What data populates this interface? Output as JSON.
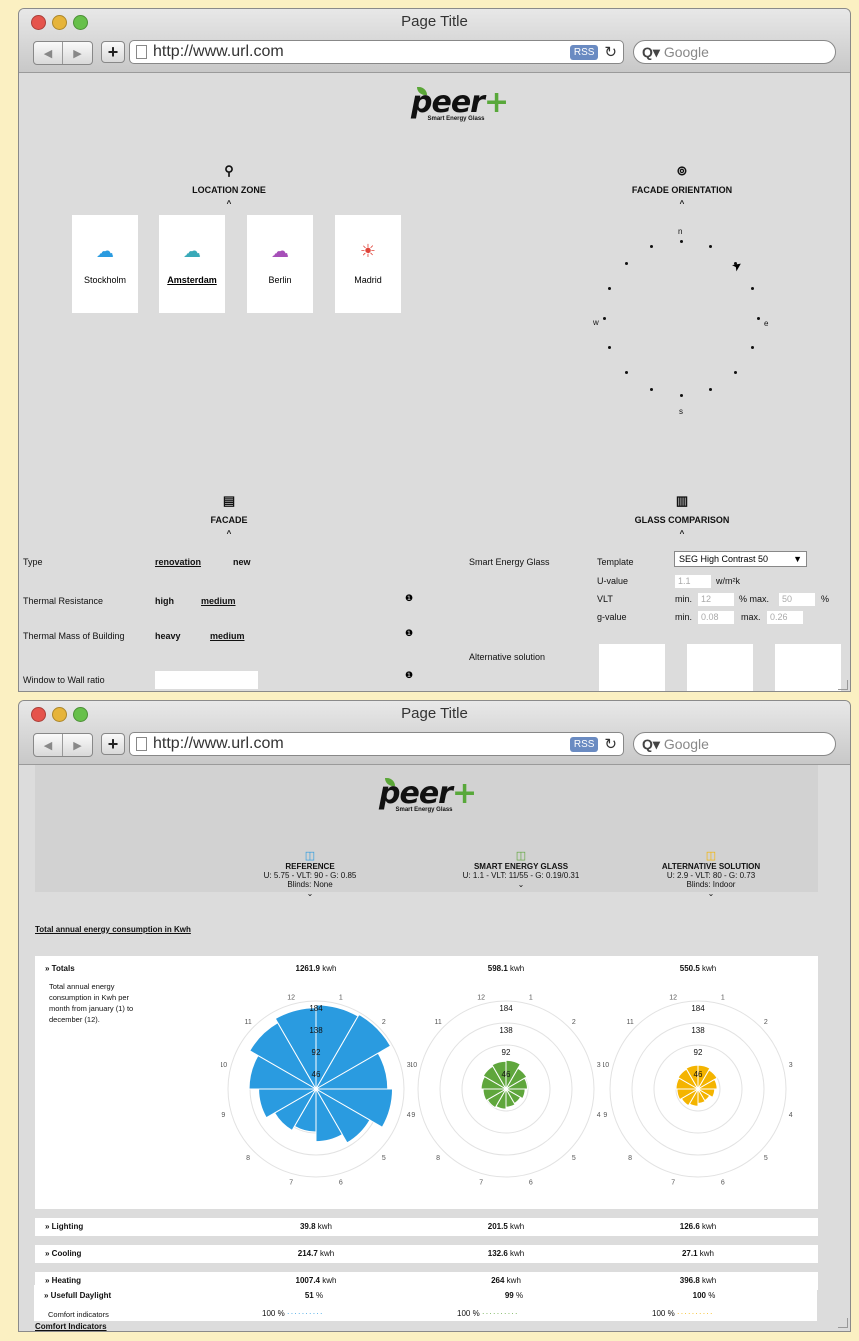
{
  "window1": {
    "title": "Page Title",
    "url": "http://www.url.com",
    "rss": "RSS",
    "search_placeholder": "Google",
    "logo": {
      "name": "peer",
      "plus": "+",
      "tagline": "Smart Energy Glass"
    },
    "location": {
      "title": "LOCATION ZONE",
      "cities": [
        "Stockholm",
        "Amsterdam",
        "Berlin",
        "Madrid"
      ]
    },
    "orientation": {
      "title": "FACADE ORIENTATION",
      "n": "n",
      "s": "s",
      "e": "e",
      "w": "w"
    },
    "facade": {
      "title": "FACADE",
      "type_label": "Type",
      "type_opt1": "renovation",
      "type_opt2": "new",
      "thermal_res_label": "Thermal Resistance",
      "thermal_res_opt1": "high",
      "thermal_res_opt2": "medium",
      "thermal_mass_label": "Thermal Mass of Building",
      "thermal_mass_opt1": "heavy",
      "thermal_mass_opt2": "medium",
      "wwr_label": "Window to Wall ratio"
    },
    "glass": {
      "title": "GLASS COMPARISON",
      "seg_label": "Smart Energy Glass",
      "template_label": "Template",
      "template_value": "SEG High Contrast 50",
      "uvalue_label": "U-value",
      "uvalue": "1.1",
      "uvalue_unit": "w/m²k",
      "vlt_label": "VLT",
      "vlt_min_label": "min.",
      "vlt_min": "12",
      "vlt_max_label": "% max.",
      "vlt_max": "50",
      "vlt_unit": "%",
      "g_label": "g-value",
      "g_min_label": "min.",
      "g_min": "0.08",
      "g_max_label": "max.",
      "g_max": "0.26",
      "alt_label": "Alternative solution"
    }
  },
  "window2": {
    "title": "Page Title",
    "url": "http://www.url.com",
    "rss": "RSS",
    "search_placeholder": "Google",
    "columns": [
      {
        "name": "REFERENCE",
        "spec": "U: 5.75 - VLT: 90 - G: 0.85",
        "blinds": "Blinds: None",
        "color": "#2a9be0"
      },
      {
        "name": "SMART ENERGY GLASS",
        "spec": "U: 1.1 - VLT: 11/55 - G: 0.19/0.31",
        "blinds": "",
        "color": "#5fa63c"
      },
      {
        "name": "ALTERNATIVE SOLUTION",
        "spec": "U: 2.9 - VLT: 80 - G: 0.73",
        "blinds": "Blinds: Indoor",
        "color": "#f4b400"
      }
    ],
    "energy_heading": "Total annual energy consumption in Kwh",
    "totals_label": "» Totals",
    "totals_desc": "Total annual energy consumption in Kwh per month from january (1) to december (12).",
    "totals": [
      "1261.9",
      "598.1",
      "550.5"
    ],
    "unit": "kwh",
    "rings": [
      "184",
      "138",
      "92",
      "46"
    ],
    "months": [
      "12",
      "1",
      "2",
      "3",
      "4",
      "5",
      "6",
      "7",
      "8",
      "9",
      "10",
      "11"
    ],
    "rows": [
      {
        "label": "» Lighting",
        "values": [
          "39.8",
          "201.5",
          "126.6"
        ]
      },
      {
        "label": "» Cooling",
        "values": [
          "214.7",
          "132.6",
          "27.1"
        ]
      },
      {
        "label": "» Heating",
        "values": [
          "1007.4",
          "264",
          "396.8"
        ]
      }
    ],
    "comfort_heading": "Comfort Indicators",
    "daylight_label": "» Usefull Daylight",
    "daylight": [
      "51",
      "99",
      "100"
    ],
    "daylight_unit": "%",
    "comfort_sub": "Comfort indicators",
    "comfort_pct": "100 %",
    "rose": [
      [
        176,
        180,
        150,
        160,
        130,
        110,
        90,
        100,
        120,
        140,
        160,
        170
      ],
      [
        60,
        50,
        45,
        40,
        35,
        38,
        42,
        45,
        48,
        52,
        55,
        58
      ],
      [
        50,
        46,
        40,
        35,
        28,
        30,
        36,
        40,
        44,
        46,
        48,
        50
      ]
    ]
  }
}
